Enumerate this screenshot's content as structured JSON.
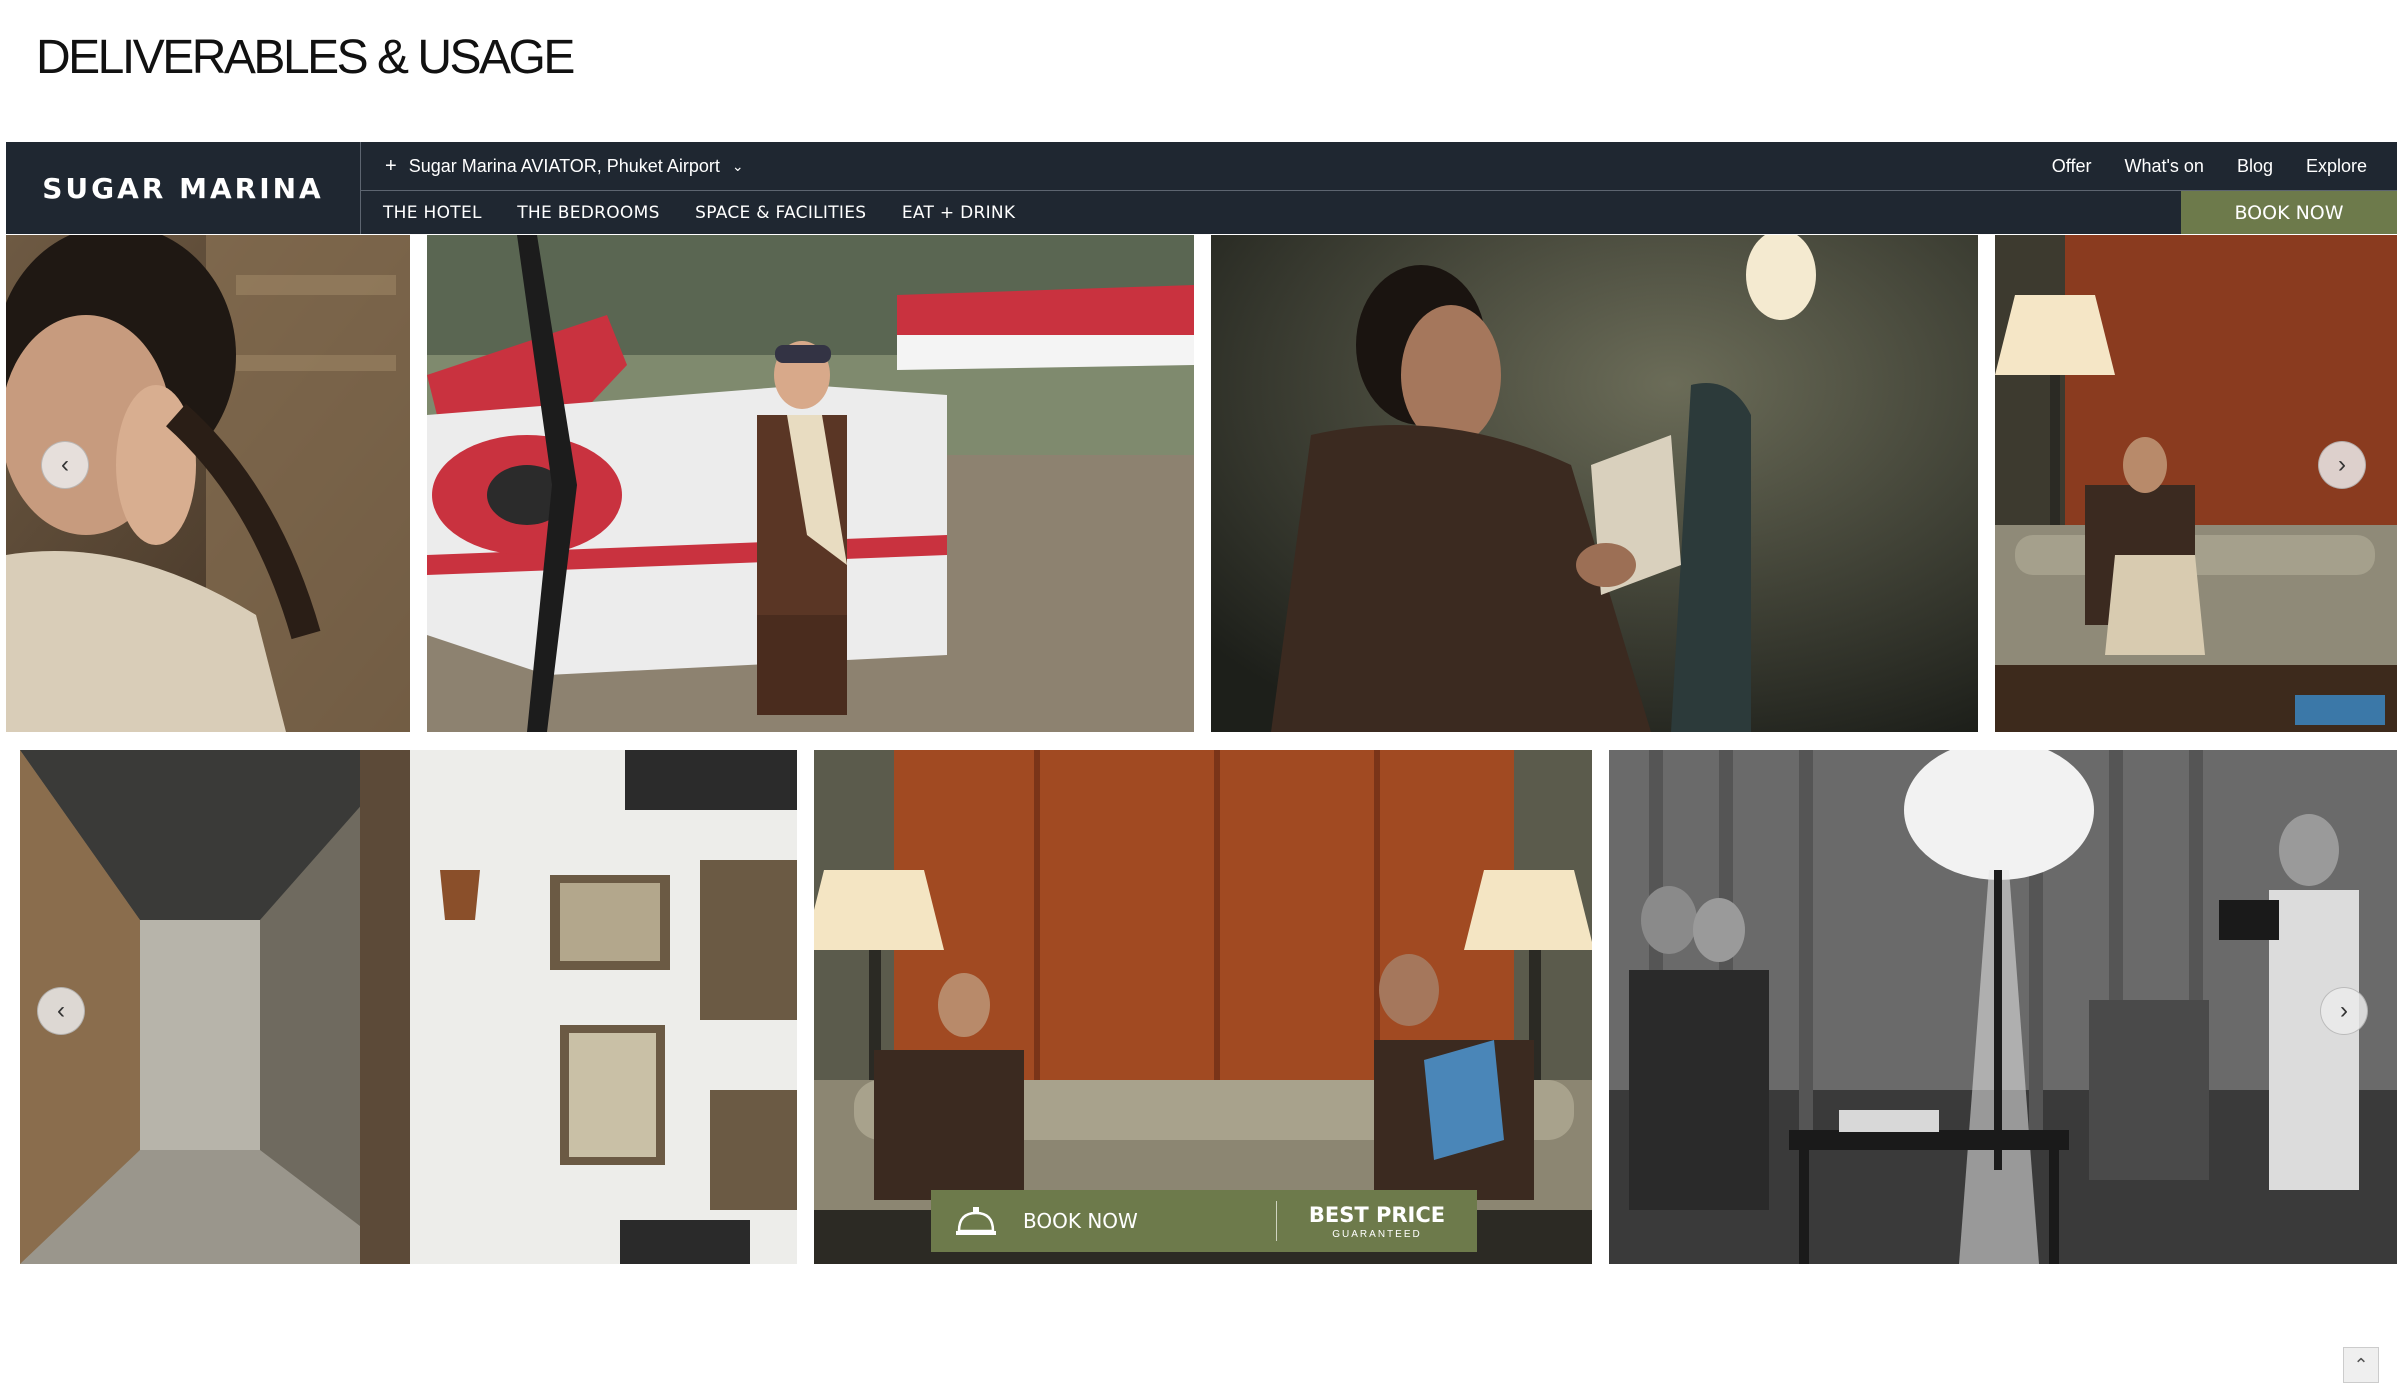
{
  "page": {
    "heading": "DELIVERABLES & USAGE"
  },
  "header": {
    "logo": "SUGAR MARINA",
    "hotel_selector": {
      "plus": "+",
      "label": "Sugar Marina AVIATOR, Phuket Airport",
      "chevron": "⌄"
    },
    "utility_nav": [
      "Offer",
      "What's on",
      "Blog",
      "Explore"
    ],
    "main_nav": [
      "THE HOTEL",
      "THE BEDROOMS",
      "SPACE & FACILITIES",
      "EAT + DRINK"
    ],
    "book_now": "BOOK NOW"
  },
  "carousel": {
    "prev_icon": "‹",
    "next_icon": "›"
  },
  "photos": [
    "woman-portrait",
    "aviator-woman-with-plane",
    "man-reading-newspaper",
    "woman-on-sofa-with-lamp",
    "hotel-corridor",
    "couple-on-sofa",
    "behind-the-scenes-bw"
  ],
  "promo": {
    "book_now": "BOOK NOW",
    "best_price": "BEST PRICE",
    "guaranteed": "GUARANTEED"
  },
  "scroll_top_icon": "⌃",
  "colors": {
    "header_bg": "#1f2731",
    "accent_olive": "#6d7a4b"
  }
}
